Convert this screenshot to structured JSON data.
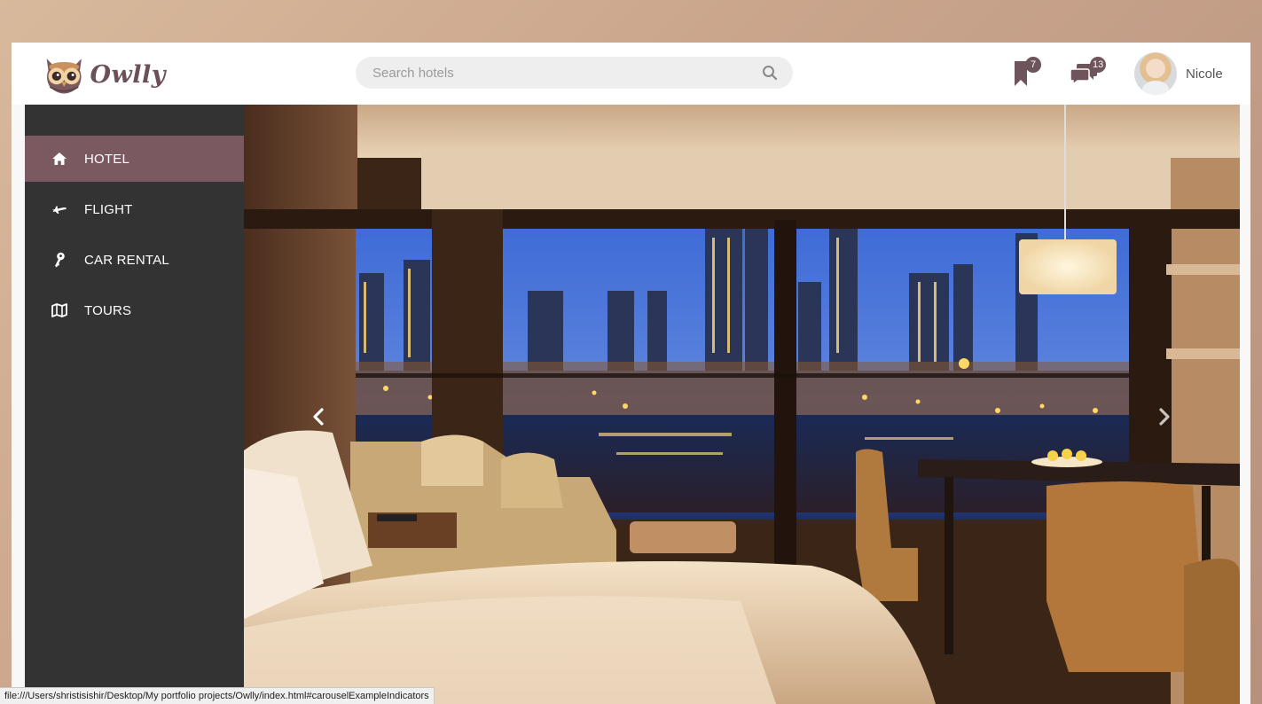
{
  "brand": {
    "name": "Owlly",
    "logo_icon": "owl-logo-icon"
  },
  "search": {
    "placeholder": "Search hotels",
    "value": "",
    "icon": "search-icon"
  },
  "header": {
    "bookmarks": {
      "icon": "bookmark-icon",
      "count": "7"
    },
    "messages": {
      "icon": "chat-bubbles-icon",
      "count": "13"
    },
    "user": {
      "name": "Nicole"
    }
  },
  "sidebar": {
    "items": [
      {
        "label": "HOTEL",
        "icon": "home-icon",
        "active": true
      },
      {
        "label": "FLIGHT",
        "icon": "plane-icon",
        "active": false
      },
      {
        "label": "CAR RENTAL",
        "icon": "key-icon",
        "active": false
      },
      {
        "label": "TOURS",
        "icon": "map-icon",
        "active": false
      }
    ]
  },
  "carousel": {
    "prev_icon": "chevron-left-icon",
    "next_icon": "chevron-right-icon"
  },
  "status_bar": {
    "url": "file:///Users/shristisishir/Desktop/My portfolio projects/Owlly/index.html#carouselExampleIndicators"
  },
  "colors": {
    "accent": "#7a5a60",
    "badge": "#6e545b",
    "sidebar_bg": "#333333",
    "header_bg": "#ffffff"
  }
}
